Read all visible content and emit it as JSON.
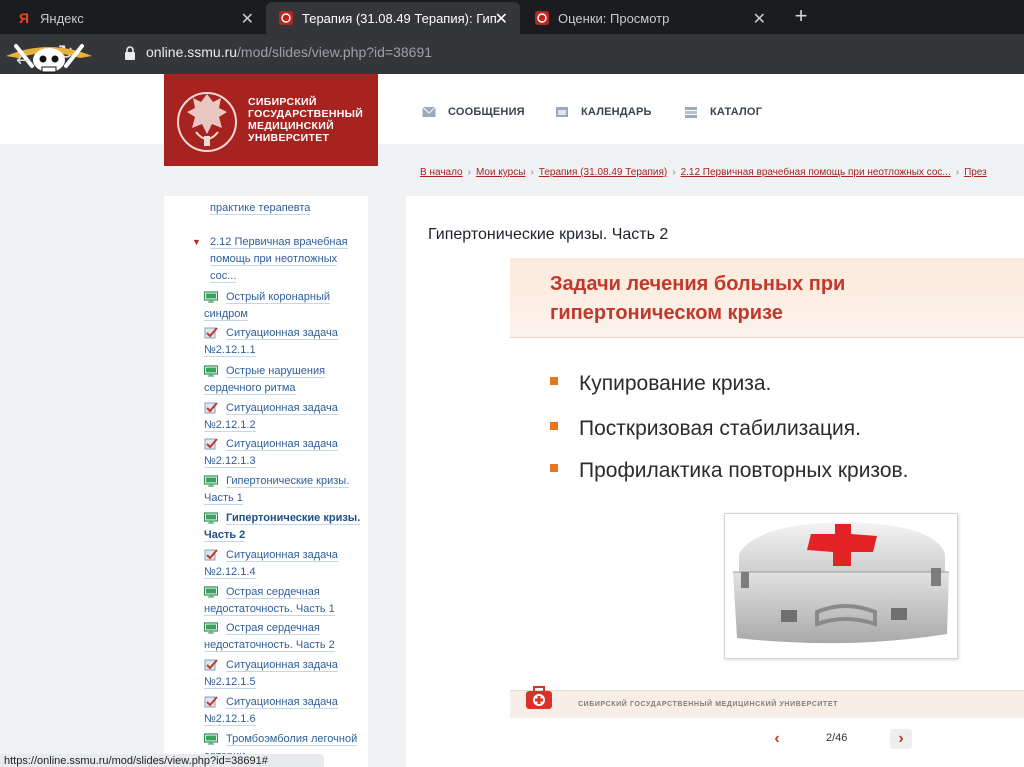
{
  "browser": {
    "tabs": [
      {
        "title": "Яндекс",
        "favicon": "yandex-icon",
        "active": false
      },
      {
        "title": "Терапия (31.08.49 Терапия): Гип",
        "favicon": "ssmu-icon",
        "active": true
      },
      {
        "title": "Оценки: Просмотр",
        "favicon": "ssmu-icon",
        "active": false
      }
    ],
    "new_tab": "+",
    "close_glyph": "✕",
    "url_host": "online.ssmu.ru",
    "url_path": "/mod/slides/view.php?id=38691",
    "status_url": "https://online.ssmu.ru/mod/slides/view.php?id=38691#"
  },
  "header": {
    "logo_lines": [
      "СИБИРСКИЙ",
      "ГОСУДАРСТВЕННЫЙ",
      "МЕДИЦИНСКИЙ",
      "УНИВЕРСИТЕТ"
    ],
    "nav": [
      {
        "label": "СООБЩЕНИЯ",
        "icon": "envelope-icon"
      },
      {
        "label": "КАЛЕНДАРЬ",
        "icon": "calendar-icon"
      },
      {
        "label": "КАТАЛОГ",
        "icon": "catalog-icon"
      }
    ]
  },
  "breadcrumb": [
    "В начало",
    "Мои курсы",
    "Терапия (31.08.49 Терапия)",
    "2.12 Первичная врачебная помощь при неотложных сос...",
    "През"
  ],
  "sidebar": {
    "top_partial": "практике терапевта",
    "section": {
      "lines": [
        "2.12 Первичная врачебная",
        "помощь при неотложных",
        "сос..."
      ]
    },
    "items": [
      {
        "type": "slides",
        "lines": [
          "Острый коронарный",
          "синдром"
        ]
      },
      {
        "type": "task",
        "lines": [
          "Ситуационная задача",
          "№2.12.1.1"
        ]
      },
      {
        "type": "slides",
        "lines": [
          "Острые нарушения",
          "сердечного ритма"
        ]
      },
      {
        "type": "task",
        "lines": [
          "Ситуационная задача",
          "№2.12.1.2"
        ]
      },
      {
        "type": "task",
        "lines": [
          "Ситуационная задача",
          "№2.12.1.3"
        ]
      },
      {
        "type": "slides",
        "lines": [
          "Гипертонические кризы.",
          "Часть 1"
        ]
      },
      {
        "type": "slides",
        "lines": [
          "Гипертонические кризы.",
          "Часть 2"
        ],
        "current": true
      },
      {
        "type": "task",
        "lines": [
          "Ситуационная задача",
          "№2.12.1.4"
        ]
      },
      {
        "type": "slides",
        "lines": [
          "Острая сердечная",
          "недостаточность. Часть 1"
        ]
      },
      {
        "type": "slides",
        "lines": [
          "Острая сердечная",
          "недостаточность. Часть 2"
        ]
      },
      {
        "type": "task",
        "lines": [
          "Ситуационная задача",
          "№2.12.1.5"
        ]
      },
      {
        "type": "task",
        "lines": [
          "Ситуационная задача",
          "№2.12.1.6"
        ]
      },
      {
        "type": "slides",
        "lines": [
          "Тромбоэмболия легочной",
          "артерии"
        ]
      }
    ]
  },
  "main": {
    "title": "Гипертонические кризы. Часть 2",
    "slide": {
      "heading_lines": [
        "Задачи лечения больных при",
        "гипертоническом кризе"
      ],
      "bullets": [
        "Купирование криза.",
        "Посткризовая стабилизация.",
        "Профилактика повторных кризов."
      ],
      "footer": "СИБИРСКИЙ ГОСУДАРСТВЕННЫЙ МЕДИЦИНСКИЙ УНИВЕРСИТЕТ"
    },
    "pager": {
      "current": 2,
      "total": 46,
      "text": "2/46",
      "prev": "‹",
      "next": "›"
    }
  },
  "colors": {
    "brand": "#a6231f",
    "link": "#2f5f9a",
    "bullet": "#e8741e"
  }
}
